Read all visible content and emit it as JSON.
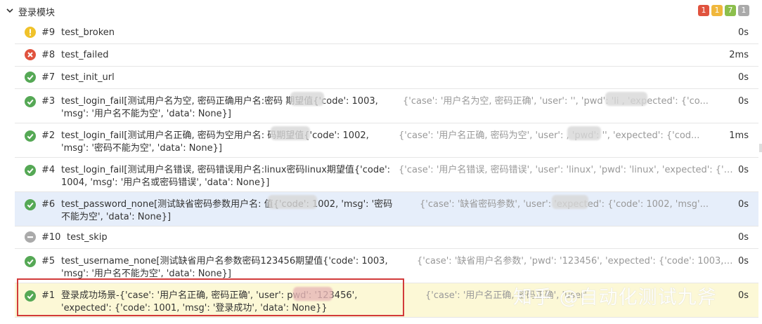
{
  "header": {
    "title": "登录模块",
    "badges": [
      {
        "count": "1",
        "color": "#e0533e"
      },
      {
        "count": "1",
        "color": "#f0b73c"
      },
      {
        "count": "7",
        "color": "#8cbf4c"
      },
      {
        "count": "1",
        "color": "#aaaaaa"
      }
    ]
  },
  "colors": {
    "passed": "#55a855",
    "failed": "#e0533e",
    "broken": "#f0c22a",
    "skipped": "#aaaaaa"
  },
  "rows": [
    {
      "status": "broken",
      "num": "#9",
      "name": "test_broken",
      "params": "",
      "duration": "0s"
    },
    {
      "status": "failed",
      "num": "#8",
      "name": "test_failed",
      "params": "",
      "duration": "2ms"
    },
    {
      "status": "passed",
      "num": "#7",
      "name": "test_init_url",
      "params": "",
      "duration": "0s"
    },
    {
      "status": "passed",
      "num": "#3",
      "name": "test_login_fail[测试用户名为空, 密码正确用户名:密码           期望值{'code': 1003, 'msg': '用户名不能为空', 'data': None}]",
      "params": "{'case': '用户名为空, 密码正确', 'user': '', 'pwd': 'li           , 'expected': {'co...",
      "duration": "0s"
    },
    {
      "status": "passed",
      "num": "#2",
      "name": "test_login_fail[测试用户名正确, 密码为空用户名:           码期望值{'code': 1002, 'msg': '密码不能为空', 'data': None}]",
      "params": "{'case': '用户名正确, 密码为空', 'user':           , 'pwd': '', 'expected': {'cod...",
      "duration": "1ms"
    },
    {
      "status": "passed",
      "num": "#4",
      "name": "test_login_fail[测试用户名错误, 密码错误用户名:linux密码linux期望值{'code': 1004, 'msg': '用户名或密码错误', 'data': None}]",
      "params": "{'case': '用户名错误, 密码错误', 'user': 'linux', 'pwd': 'linux', 'expected': {'co...",
      "duration": "0s"
    },
    {
      "status": "passed",
      "num": "#6",
      "name": "test_password_none[测试缺省密码参数用户名:           值{'code': 1002, 'msg': '密码不能为空', 'data': None}]",
      "params": "{'case': '缺省密码参数', 'user':           'expected': {'code': 1002, 'msg'...",
      "duration": "0s"
    },
    {
      "status": "skipped",
      "num": "#10",
      "name": "test_skip",
      "params": "",
      "duration": "0s"
    },
    {
      "status": "passed",
      "num": "#5",
      "name": "test_username_none[测试缺省用户名参数密码123456期望值{'code': 1003, 'msg': '用户名不能为空', 'data': None}]",
      "params": "{'case': '缺省用户名参数', 'pwd': '123456', 'expected': {'code': 1003, 'm...",
      "duration": "0s"
    },
    {
      "status": "passed",
      "num": "#1",
      "name": "登录成功场景-{'case': '用户名正确, 密码正确', 'user':           pwd': '123456', 'expected': {'code': 1001, 'msg': '登录成功', 'data': None}}",
      "params": "{'case': '用户名正确, 密码正确', 'user'",
      "duration": "0s"
    }
  ],
  "watermark": "知乎 @自动化测试九斧"
}
